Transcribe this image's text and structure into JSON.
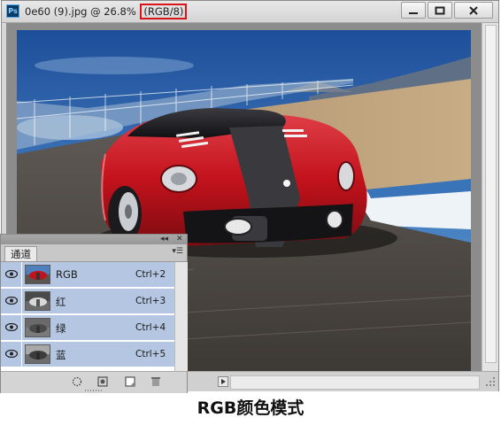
{
  "window": {
    "logo_text": "Ps",
    "title": "0e60 (9).jpg @ 26.8%",
    "color_mode": "(RGB/8)",
    "minimize_label": "minimize",
    "maximize_label": "maximize",
    "close_label": "close"
  },
  "channels_panel": {
    "tab_label": "通道",
    "channels": [
      {
        "name": "RGB",
        "shortcut": "Ctrl+2",
        "thumb": "color"
      },
      {
        "name": "红",
        "shortcut": "Ctrl+3",
        "thumb": "gray"
      },
      {
        "name": "绿",
        "shortcut": "Ctrl+4",
        "thumb": "gray"
      },
      {
        "name": "蓝",
        "shortcut": "Ctrl+5",
        "thumb": "gray"
      }
    ],
    "footer_icons": [
      "load-selection-icon",
      "save-selection-icon",
      "new-channel-icon",
      "delete-channel-icon"
    ]
  },
  "caption": "RGB颜色模式",
  "colors": {
    "selected_row": "#b5c6e2",
    "mode_highlight": "#d8141a",
    "car_red": "#c3121c"
  }
}
